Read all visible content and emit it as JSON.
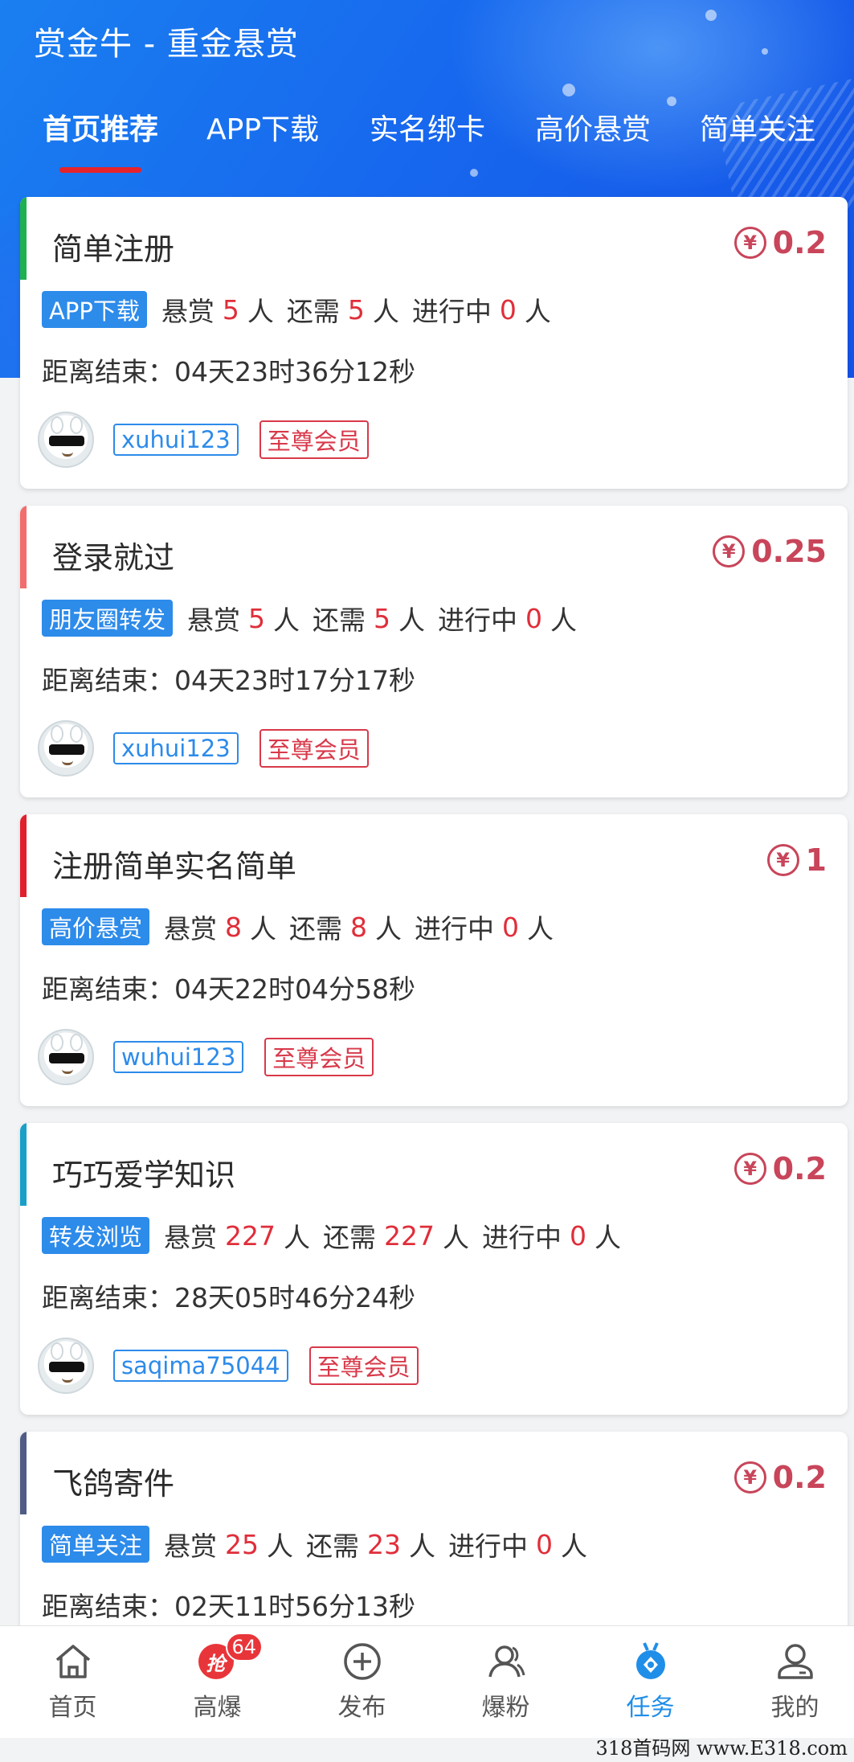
{
  "app": {
    "title": "赏金牛 - 重金悬赏"
  },
  "tabs": [
    {
      "label": "首页推荐",
      "active": true
    },
    {
      "label": "APP下载",
      "active": false
    },
    {
      "label": "实名绑卡",
      "active": false
    },
    {
      "label": "高价悬赏",
      "active": false
    },
    {
      "label": "简单关注",
      "active": false
    }
  ],
  "labels": {
    "reward": "悬赏",
    "remaining": "还需",
    "in_progress": "进行中",
    "person_unit": "人",
    "deadline_prefix": "距离结束："
  },
  "tasks": [
    {
      "title": "简单注册",
      "reward": "0.2",
      "tag": "APP下载",
      "bounty": "5",
      "remaining": "5",
      "in_progress": "0",
      "countdown": "04天23时36分12秒",
      "user": "xuhui123",
      "membership": "至尊会员",
      "accent_color": "#1fb050"
    },
    {
      "title": "登录就过",
      "reward": "0.25",
      "tag": "朋友圈转发",
      "bounty": "5",
      "remaining": "5",
      "in_progress": "0",
      "countdown": "04天23时17分17秒",
      "user": "xuhui123",
      "membership": "至尊会员",
      "accent_color": "#f26d6d"
    },
    {
      "title": "注册简单实名简单",
      "reward": "1",
      "tag": "高价悬赏",
      "bounty": "8",
      "remaining": "8",
      "in_progress": "0",
      "countdown": "04天22时04分58秒",
      "user": "wuhui123",
      "membership": "至尊会员",
      "accent_color": "#e0202d"
    },
    {
      "title": "巧巧爱学知识",
      "reward": "0.2",
      "tag": "转发浏览",
      "bounty": "227",
      "remaining": "227",
      "in_progress": "0",
      "countdown": "28天05时46分24秒",
      "user": "saqima75044",
      "membership": "至尊会员",
      "accent_color": "#1aa0c8"
    },
    {
      "title": "飞鸽寄件",
      "reward": "0.2",
      "tag": "简单关注",
      "bounty": "25",
      "remaining": "23",
      "in_progress": "0",
      "countdown": "02天11时56分13秒",
      "user": "",
      "membership": "",
      "accent_color": "#4f5d86"
    }
  ],
  "bottom_nav": [
    {
      "label": "首页",
      "icon": "home-icon",
      "active": false
    },
    {
      "label": "高爆",
      "icon": "grab-icon",
      "active": false,
      "badge": "64",
      "icon_text": "抢"
    },
    {
      "label": "发布",
      "icon": "plus-circle-icon",
      "active": false
    },
    {
      "label": "爆粉",
      "icon": "users-icon",
      "active": false
    },
    {
      "label": "任务",
      "icon": "task-medal-icon",
      "active": true
    },
    {
      "label": "我的",
      "icon": "profile-icon",
      "active": false
    }
  ],
  "colors": {
    "primary": "#1768ee",
    "accent_blue": "#2d8bea",
    "accent_red": "#e02e3a",
    "reward": "#c8455a"
  },
  "watermark": "318首码网 www.E318.com"
}
